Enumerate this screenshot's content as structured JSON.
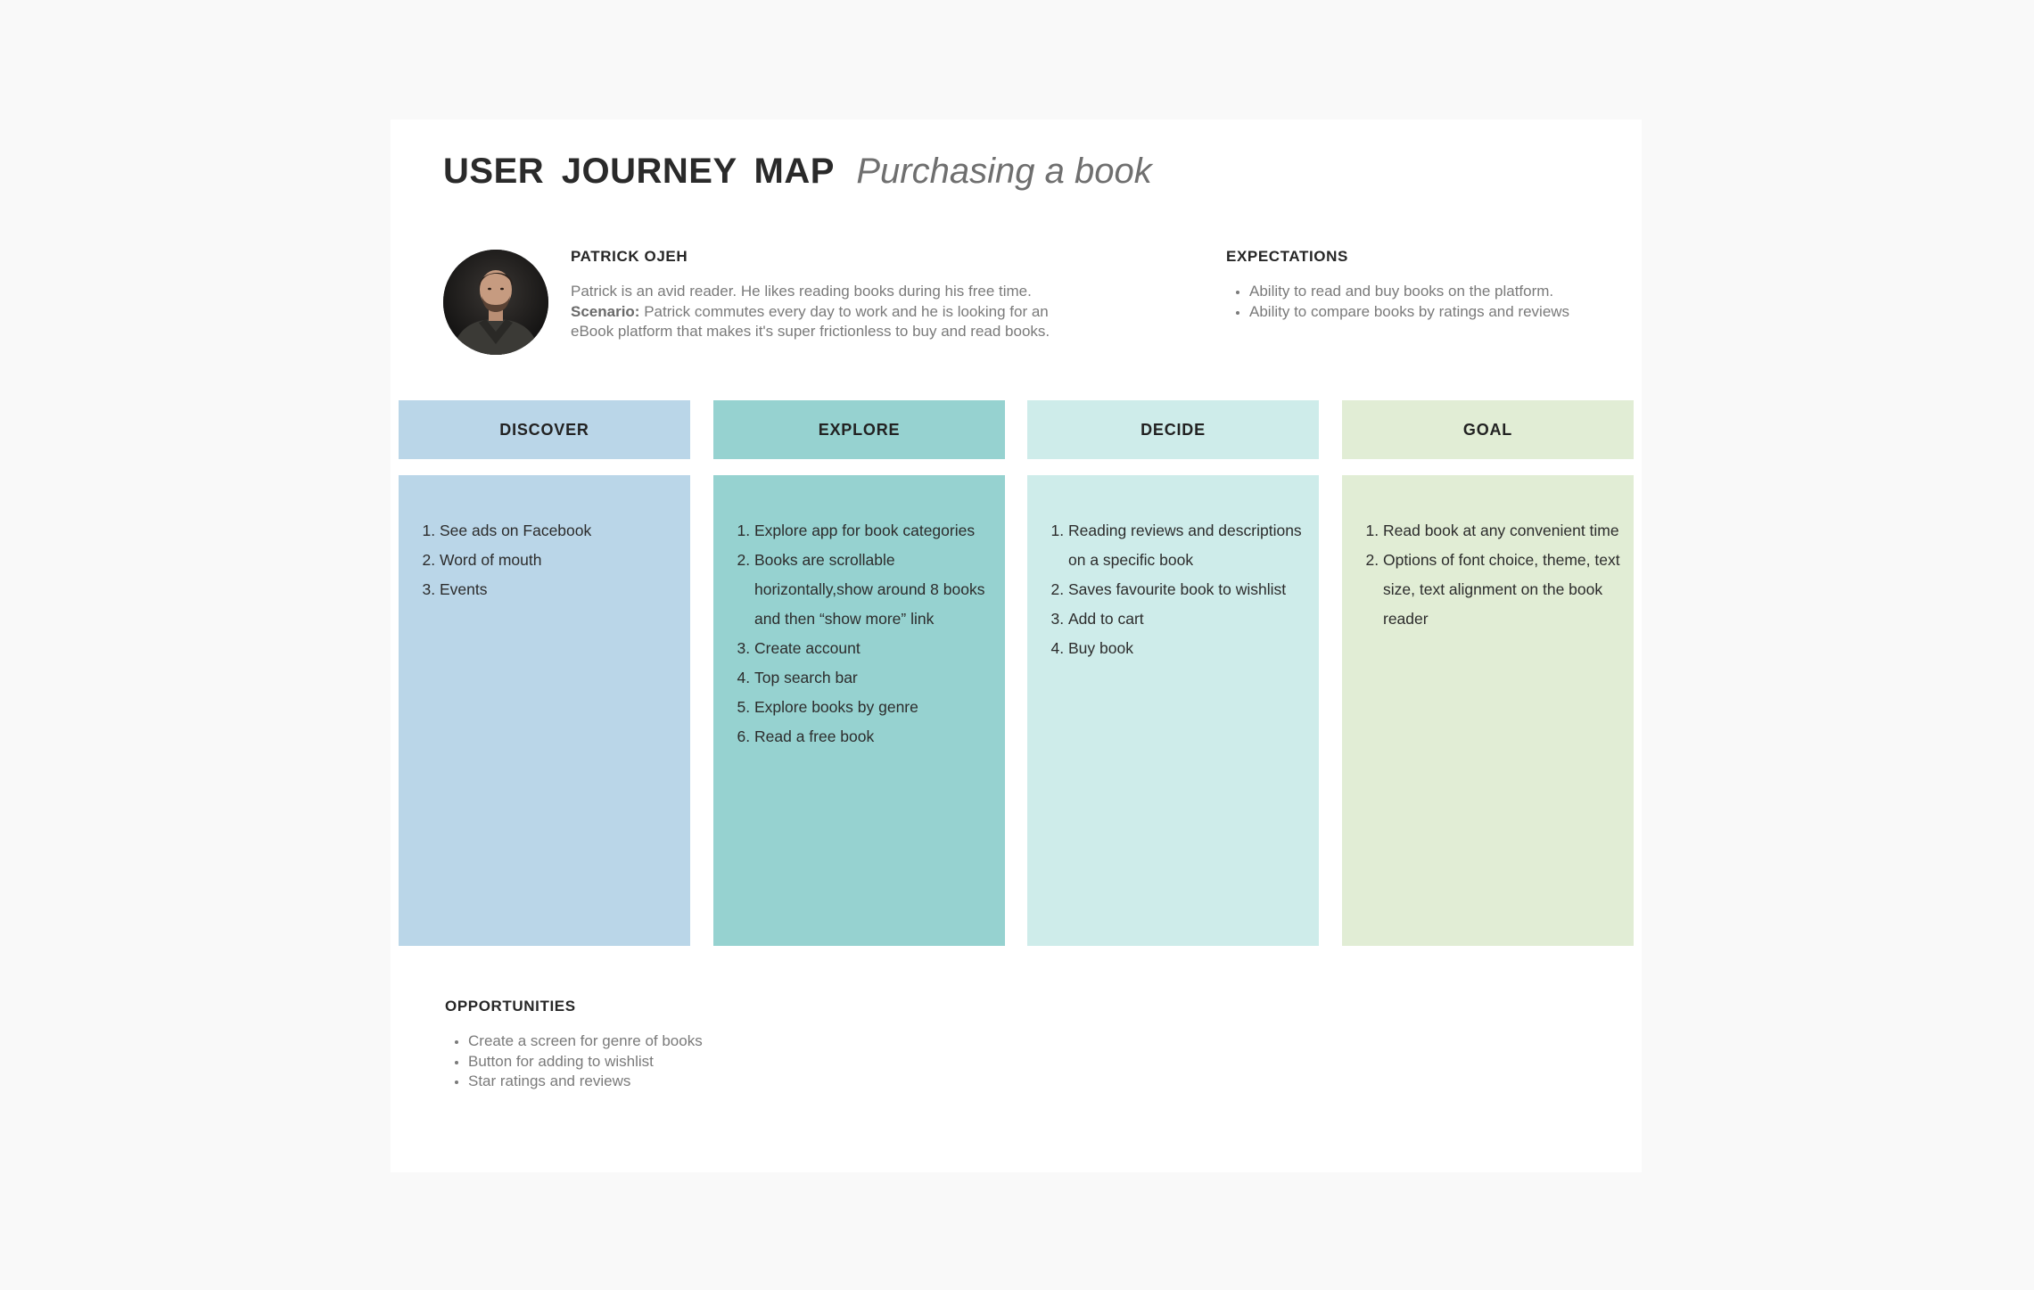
{
  "header": {
    "title": "USER  JOURNEY MAP",
    "subtitle": "Purchasing a book"
  },
  "persona": {
    "avatar_icon": "person-portrait-icon",
    "name": "PATRICK OJEH",
    "description": "Patrick is an avid reader. He likes reading books during his free time.",
    "scenario_label": "Scenario:",
    "scenario_text": "Patrick commutes every day to work and he is looking for an eBook platform that makes it's super frictionless to buy and read books."
  },
  "expectations": {
    "heading": "EXPECTATIONS",
    "items": [
      "Ability to read and buy books on the platform.",
      "Ability to compare books by ratings and reviews"
    ]
  },
  "stages": [
    {
      "label": "DISCOVER",
      "color": "#bad6e8",
      "items": [
        "See ads on Facebook",
        "Word of mouth",
        "Events"
      ]
    },
    {
      "label": "EXPLORE",
      "color": "#96d2d0",
      "items": [
        "Explore app for book categories",
        "Books are scrollable horizontally,show around 8 books and then “show more” link",
        "Create account",
        "Top search bar",
        "Explore books by genre",
        "Read a free book"
      ]
    },
    {
      "label": "DECIDE",
      "color": "#ceecea",
      "items": [
        "Reading reviews and descriptions on a specific book",
        "Saves favourite book to wishlist",
        "Add to cart",
        "Buy book"
      ]
    },
    {
      "label": "GOAL",
      "color": "#e1edd5",
      "items": [
        "Read book at any convenient time",
        "Options of font choice, theme, text size, text alignment on the book reader"
      ]
    }
  ],
  "opportunities": {
    "heading": "OPPORTUNITIES",
    "items": [
      "Create a screen for genre of books",
      "Button for adding to wishlist",
      "Star ratings and reviews"
    ]
  }
}
